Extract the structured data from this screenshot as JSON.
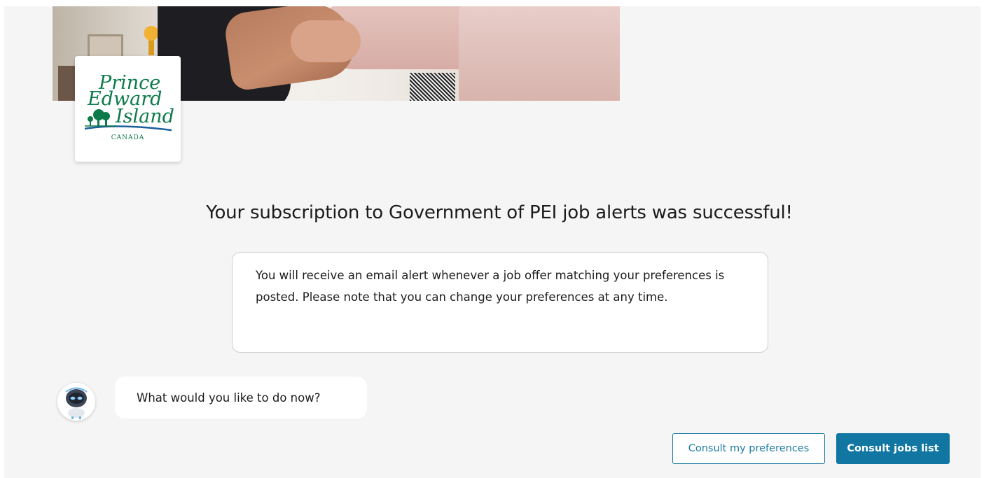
{
  "logo": {
    "line1": "Prince",
    "line2": "Edward",
    "line3": "Island",
    "country": "CANADA"
  },
  "headline": "Your subscription to Government of PEI job alerts was successful!",
  "info": {
    "text": "You will receive an email alert whenever a job offer matching your preferences is posted. Please note that you can change your preferences at any time."
  },
  "chat": {
    "message": "What would you like to do now?"
  },
  "actions": {
    "consult_preferences": "Consult my preferences",
    "consult_jobs": "Consult jobs list"
  },
  "colors": {
    "accent": "#1276a3",
    "logo_green": "#0d7a4a",
    "background": "#f5f5f5"
  }
}
